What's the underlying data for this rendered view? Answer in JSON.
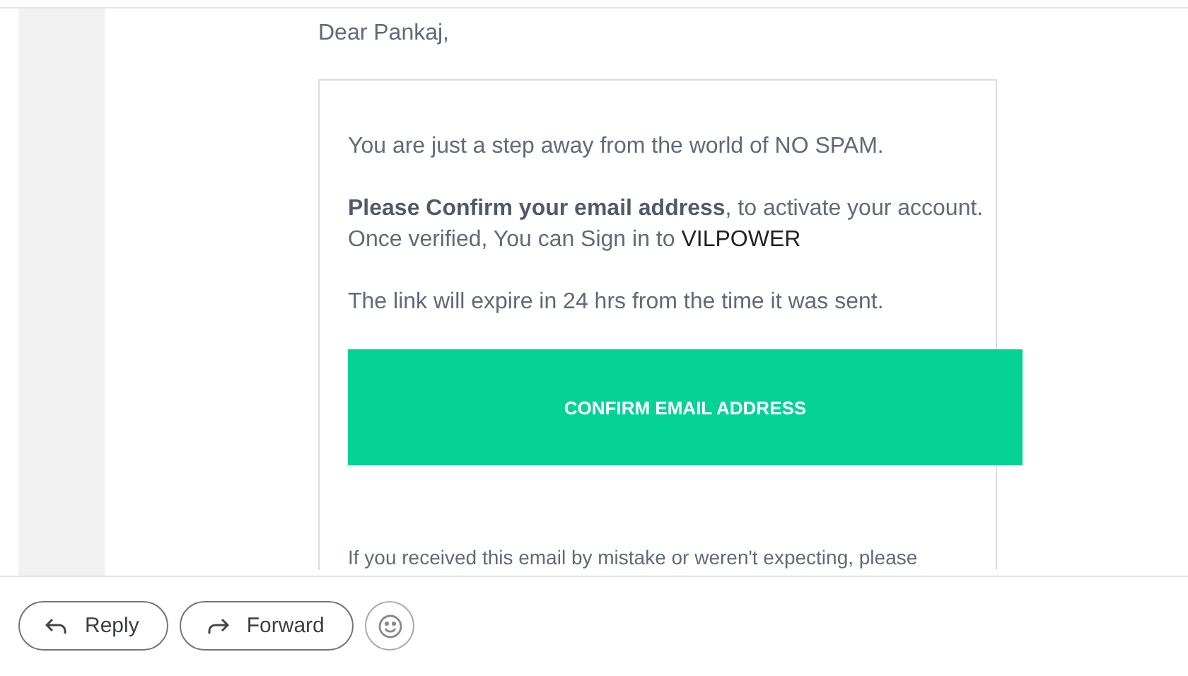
{
  "greeting": "Dear Pankaj,",
  "card": {
    "paragraphs": [
      {
        "lines": [
          {
            "text": "You are just a step away from the world of NO SPAM."
          }
        ]
      },
      {
        "lines": [
          {
            "text": "**Please Confirm your email address**, to activate your account."
          },
          {
            "text": "Once verified, You can Sign in to",
            "highlight": "VILPOWER"
          }
        ]
      },
      {
        "lines": [
          {
            "text": "The link will expire in 24 hrs from the time it was sent."
          }
        ]
      }
    ],
    "button": "CONFIRM EMAIL ADDRESS",
    "footnote": "If you received this email by mistake or weren't expecting, please"
  },
  "actions": [
    {
      "kind": "reply",
      "label": "Reply"
    },
    {
      "kind": "forward",
      "label": "Forward"
    },
    {
      "kind": "emoji"
    }
  ]
}
